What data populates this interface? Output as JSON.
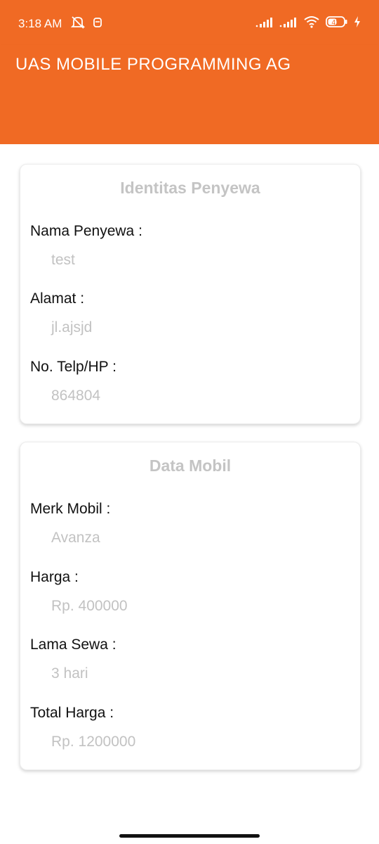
{
  "status_bar": {
    "time": "3:18 AM",
    "battery_level": "41",
    "icons": [
      "mute-notification-icon",
      "notification-app-icon",
      "signal-icon",
      "signal-icon",
      "wifi-icon",
      "battery-icon",
      "charging-bolt-icon"
    ]
  },
  "app_bar": {
    "title": "UAS MOBILE PROGRAMMING AG"
  },
  "card_renter": {
    "title": "Identitas Penyewa",
    "fields": [
      {
        "label": "Nama Penyewa :",
        "value": "test"
      },
      {
        "label": "Alamat :",
        "value": "jl.ajsjd"
      },
      {
        "label": "No. Telp/HP :",
        "value": "864804"
      }
    ]
  },
  "card_car": {
    "title": "Data Mobil",
    "fields": [
      {
        "label": "Merk Mobil :",
        "value": "Avanza"
      },
      {
        "label": "Harga :",
        "value": "Rp. 400000"
      },
      {
        "label": "Lama Sewa :",
        "value": "3 hari"
      },
      {
        "label": "Total Harga :",
        "value": "Rp. 1200000"
      }
    ]
  },
  "colors": {
    "primary": "#f06a24",
    "label_text": "#111111",
    "value_text": "#c2c2c2",
    "card_title": "#c4c4c4"
  }
}
